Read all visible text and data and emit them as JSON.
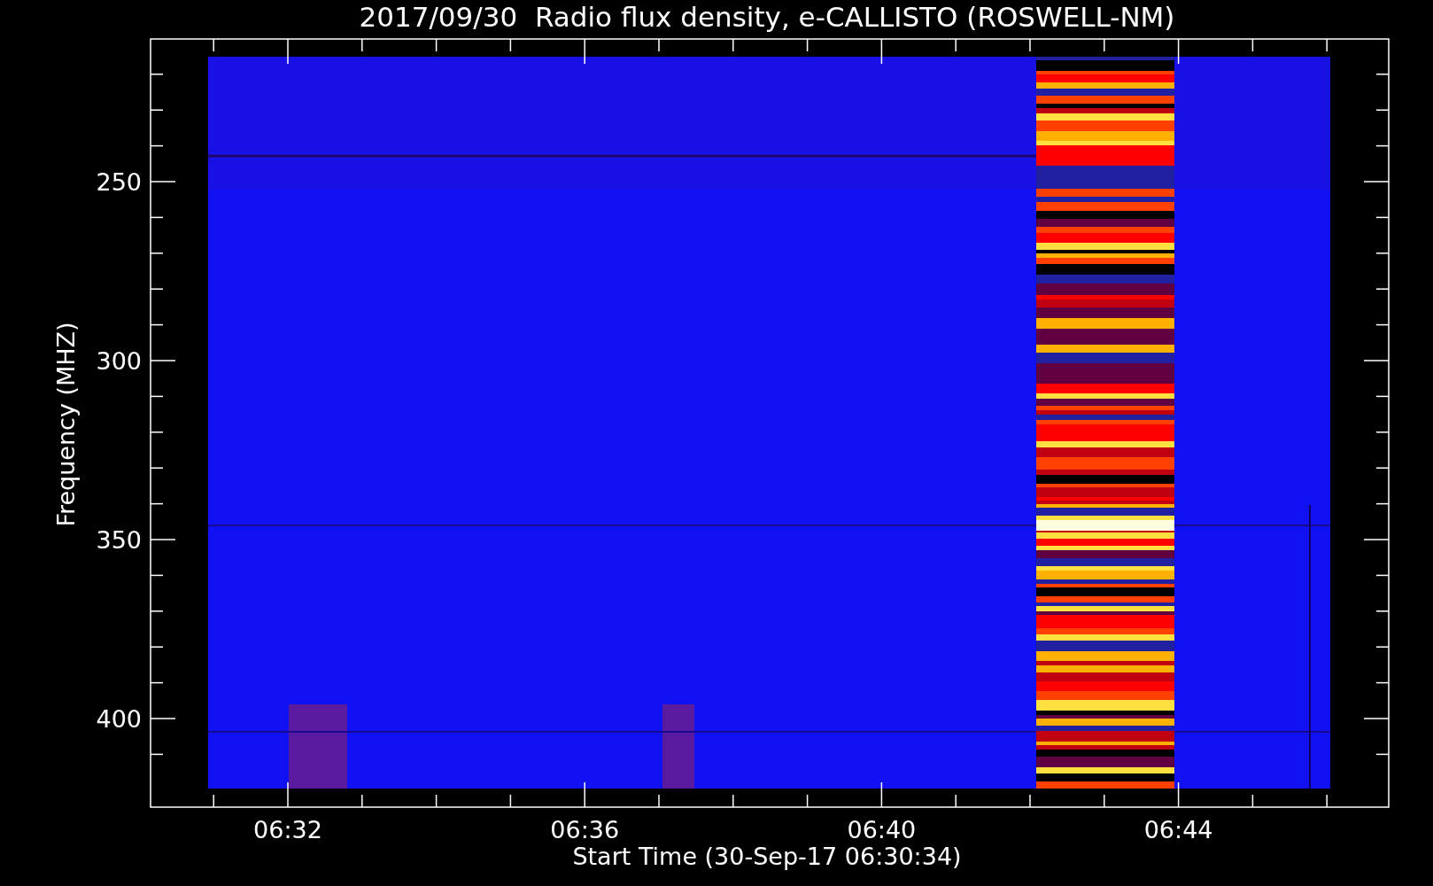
{
  "plot": {
    "title": "2017/09/30  Radio flux density, e-CALLISTO (ROSWELL-NM)",
    "xlabel": "Start Time (30-Sep-17 06:30:34)",
    "ylabel": "Frequency (MHZ)",
    "yticks": [
      "250",
      "300",
      "350",
      "400"
    ],
    "xticks": [
      "06:32",
      "06:36",
      "06:40",
      "06:44"
    ]
  }
}
